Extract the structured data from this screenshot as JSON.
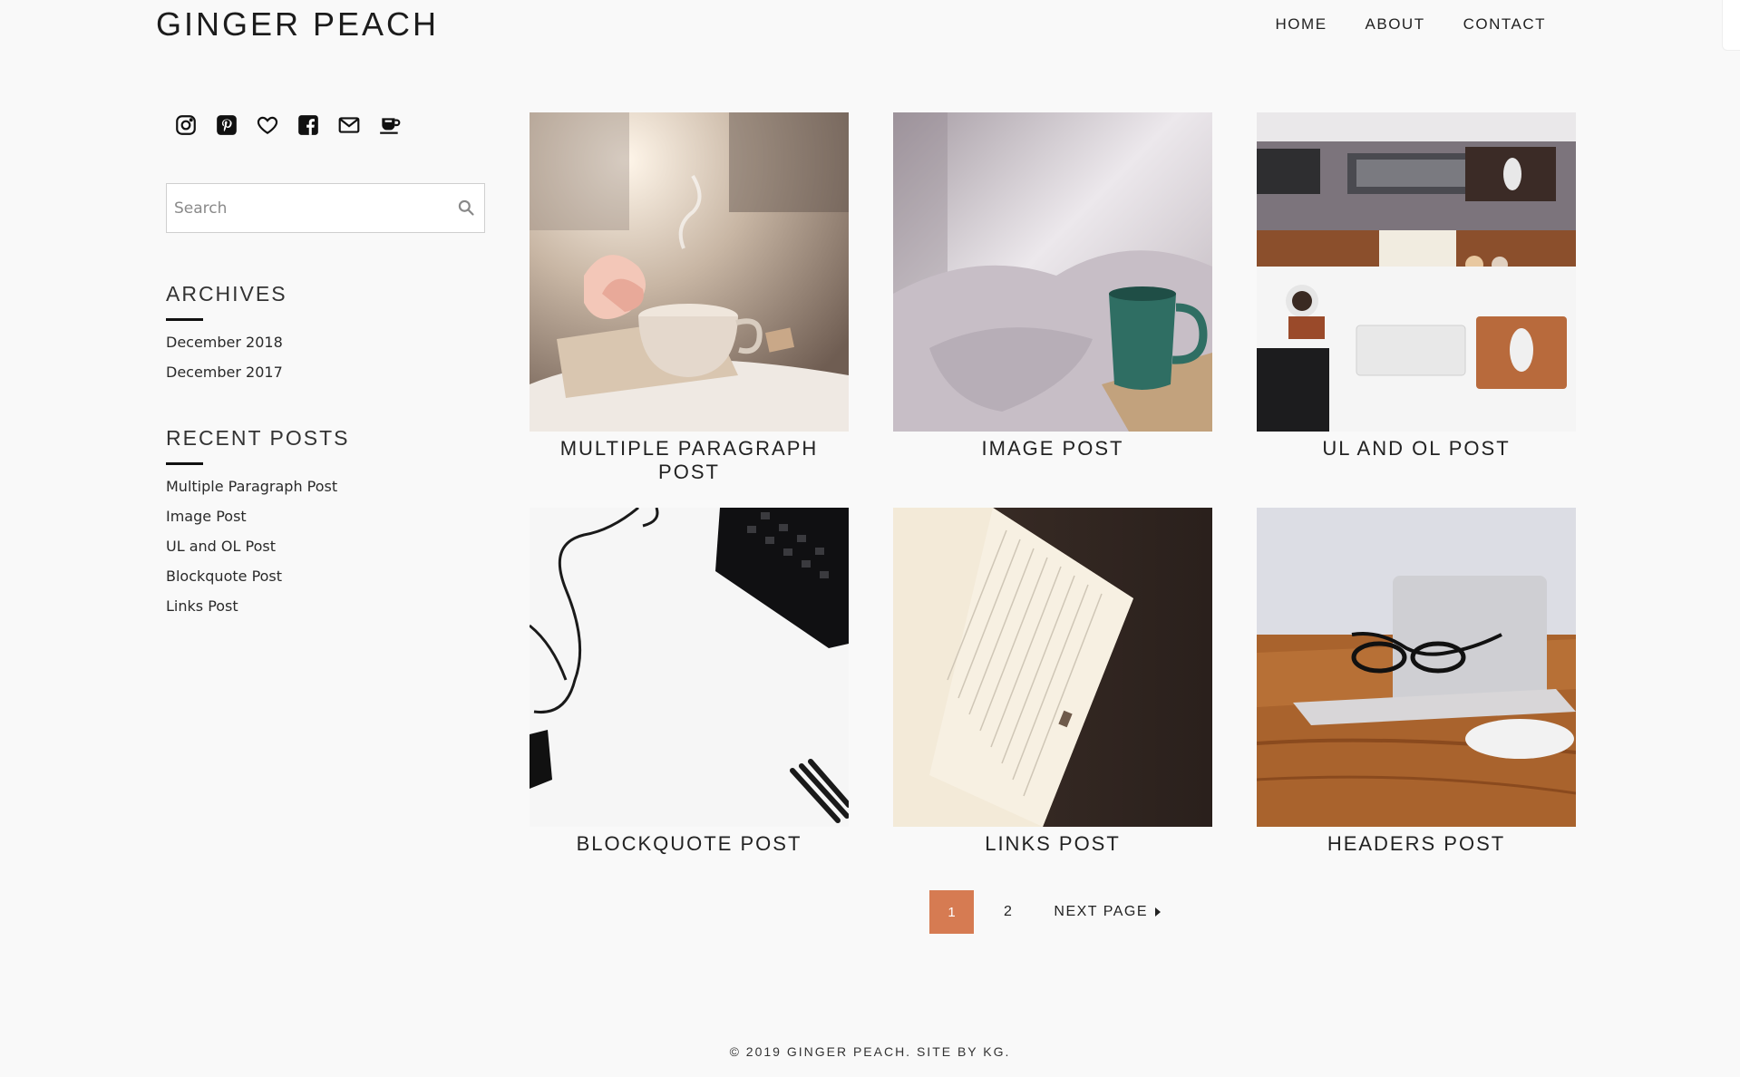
{
  "header": {
    "site_title": "GINGER PEACH",
    "nav": [
      "HOME",
      "ABOUT",
      "CONTACT"
    ]
  },
  "sidebar": {
    "social_icons": [
      "instagram-icon",
      "pinterest-icon",
      "heart-icon",
      "facebook-icon",
      "mail-icon",
      "coffee-cup-icon"
    ],
    "search": {
      "placeholder": "Search"
    },
    "archives": {
      "title": "ARCHIVES",
      "items": [
        "December 2018",
        "December 2017"
      ]
    },
    "recent_posts": {
      "title": "RECENT POSTS",
      "items": [
        "Multiple Paragraph Post",
        "Image Post",
        "UL and OL Post",
        "Blockquote Post",
        "Links Post"
      ]
    }
  },
  "posts": [
    {
      "title": "MULTIPLE PARAGRAPH POST",
      "image": "teacup-on-book-photo"
    },
    {
      "title": "IMAGE POST",
      "image": "green-mug-bed-photo"
    },
    {
      "title": "UL AND OL POST",
      "image": "desk-flatlay-photo"
    },
    {
      "title": "BLOCKQUOTE POST",
      "image": "keyboard-earphones-photo"
    },
    {
      "title": "LINKS POST",
      "image": "open-notebook-photo"
    },
    {
      "title": "HEADERS POST",
      "image": "glasses-laptop-photo"
    }
  ],
  "pagination": {
    "current": "1",
    "next_number": "2",
    "next_label": "NEXT PAGE"
  },
  "footer": {
    "text": "© 2019 GINGER PEACH. SITE BY KG."
  },
  "colors": {
    "accent": "#d67b52",
    "background": "#f9f9f9"
  }
}
